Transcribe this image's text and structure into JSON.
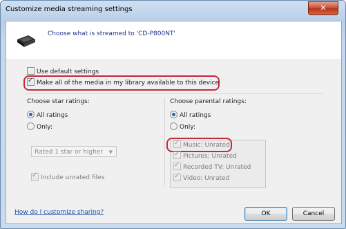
{
  "window": {
    "title": "Customize media streaming settings",
    "close_glyph": "✕"
  },
  "header": {
    "icon": "media-device-icon",
    "text": "Choose what is streamed to 'CD-P800NT'"
  },
  "options": {
    "use_default": {
      "label": "Use default settings",
      "checked": false
    },
    "make_all": {
      "label": "Make all of the media in my library available to this device",
      "checked": true
    }
  },
  "star_ratings": {
    "heading": "Choose star ratings:",
    "all_label": "All ratings",
    "only_label": "Only:",
    "selected": "All ratings",
    "combo_value": "Rated 1 star or higher",
    "include_unrated": {
      "label": "Include unrated files",
      "checked": true
    }
  },
  "parental_ratings": {
    "heading": "Choose parental ratings:",
    "all_label": "All ratings",
    "only_label": "Only:",
    "selected": "All ratings",
    "items": [
      {
        "label": "Music: Unrated",
        "checked": true
      },
      {
        "label": "Pictures: Unrated",
        "checked": true
      },
      {
        "label": "Recorded TV: Unrated",
        "checked": true
      },
      {
        "label": "Video: Unrated",
        "checked": true
      }
    ]
  },
  "footer": {
    "help_link": "How do I customize sharing?",
    "ok_label": "OK",
    "cancel_label": "Cancel"
  },
  "colors": {
    "highlight": "#c5283b",
    "link": "#1a52a8"
  }
}
